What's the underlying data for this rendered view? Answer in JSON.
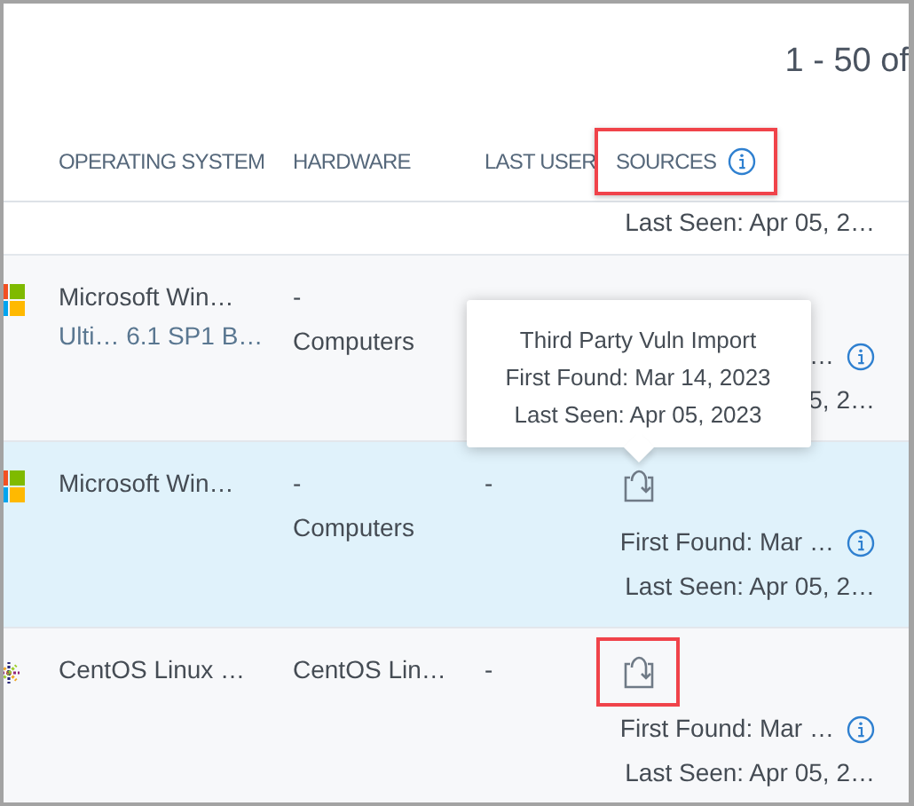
{
  "pagination": {
    "range": "1 - 50 of"
  },
  "columns": [
    {
      "label": "OPERATING SYSTEM"
    },
    {
      "label": "HARDWARE"
    },
    {
      "label": "LAST USER"
    },
    {
      "label": "SOURCES",
      "info": true,
      "highlighted": true
    }
  ],
  "rows": [
    {
      "sources": {
        "last_seen": "Last Seen: Apr 05, 2…"
      }
    },
    {
      "kind": "windows",
      "selected": false,
      "os": "Microsoft Win…",
      "os_version": "Ulti… 6.1 SP1 B…",
      "hardware": "-",
      "hardware_type": "Computers",
      "sources": {
        "first_found": "…",
        "info": true,
        "last_seen": "5, 2…"
      }
    },
    {
      "kind": "windows",
      "selected": true,
      "os": "Microsoft Win…",
      "hardware": "-",
      "hardware_type": "Computers",
      "last_user": "-",
      "sources": {
        "icon": {
          "highlighted": false,
          "tooltip": {
            "title": "Third Party Vuln Import",
            "first_found": "First Found: Mar 14, 2023",
            "last_seen": "Last Seen: Apr 05, 2023"
          }
        },
        "first_found": "First Found: Mar …",
        "info": true,
        "last_seen": "Last Seen: Apr 05, 2…"
      }
    },
    {
      "kind": "centos",
      "selected": false,
      "os": "CentOS Linux …",
      "hardware": "CentOS Lin…",
      "last_user": "-",
      "sources": {
        "icon": {
          "highlighted": true
        },
        "first_found": "First Found: Mar …",
        "info": true,
        "last_seen": "Last Seen: Apr 05, 2…"
      }
    }
  ]
}
